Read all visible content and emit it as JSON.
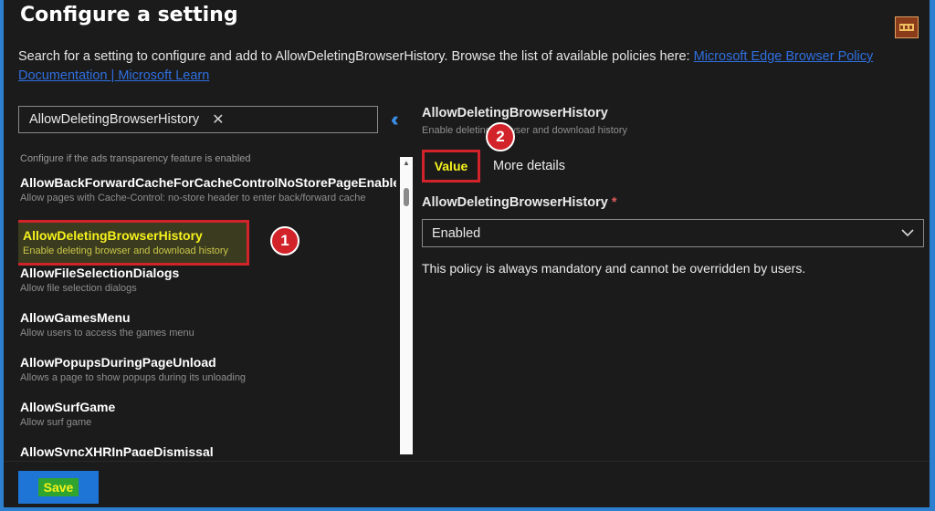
{
  "header": {
    "title": "Configure a setting",
    "logo_text": "HTMD"
  },
  "description": {
    "text": "Search for a setting to configure and add to AllowDeletingBrowserHistory. Browse the list of available policies here: ",
    "link": "Microsoft Edge Browser Policy Documentation | Microsoft Learn"
  },
  "search": {
    "value": "AllowDeletingBrowserHistory",
    "clear_icon": "close-icon"
  },
  "list": {
    "first_desc": "Configure if the ads transparency feature is enabled",
    "items": [
      {
        "name": "AllowBackForwardCacheForCacheControlNoStorePageEnabled",
        "desc": "Allow pages with Cache-Control: no-store header to enter back/forward cache"
      },
      {
        "name": "AllowDeletingBrowserHistory",
        "desc": "Enable deleting browser and download history"
      },
      {
        "name": "AllowFileSelectionDialogs",
        "desc": "Allow file selection dialogs"
      },
      {
        "name": "AllowGamesMenu",
        "desc": "Allow users to access the games menu"
      },
      {
        "name": "AllowPopupsDuringPageUnload",
        "desc": "Allows a page to show popups during its unloading"
      },
      {
        "name": "AllowSurfGame",
        "desc": "Allow surf game"
      },
      {
        "name": "AllowSyncXHRInPageDismissal",
        "desc": ""
      }
    ]
  },
  "annotations": {
    "badge1": "1",
    "badge2": "2"
  },
  "detail": {
    "title": "AllowDeletingBrowserHistory",
    "subtitle": "Enable deleting browser and download history",
    "tab_value": "Value",
    "tab_more": "More details",
    "field_label": "AllowDeletingBrowserHistory",
    "required_mark": "*",
    "select_value": "Enabled",
    "note": "This policy is always mandatory and cannot be overridden by users."
  },
  "footer": {
    "save_label": "Save"
  },
  "colors": {
    "accent": "#1f75d6",
    "highlight": "#f6f31c",
    "annotation": "#d2232a"
  }
}
